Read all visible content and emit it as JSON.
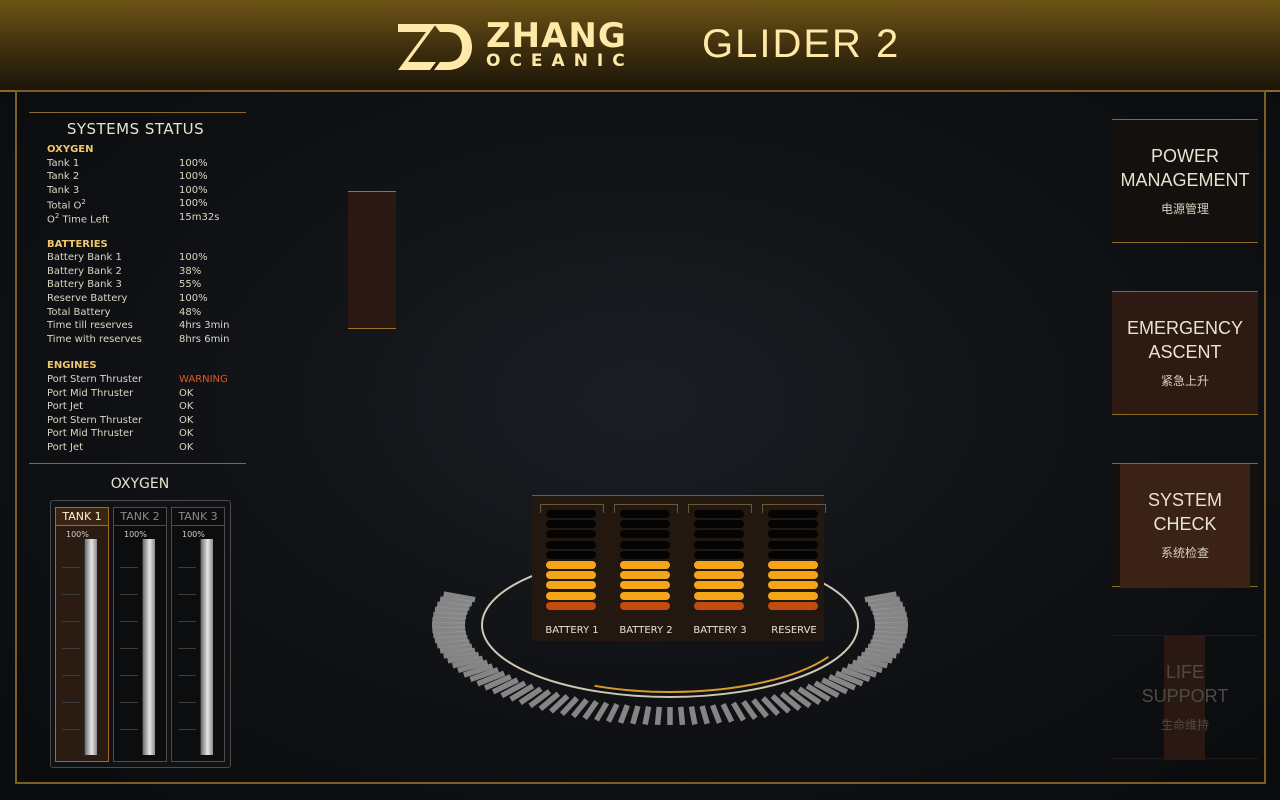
{
  "header": {
    "brand_top": "ZHANG",
    "brand_bottom": "OCEANIC",
    "product": "GLIDER 2",
    "logo_icon": "zd-logo-icon"
  },
  "systems_status": {
    "title": "SYSTEMS STATUS",
    "sections": [
      {
        "heading": "OXYGEN",
        "rows": [
          {
            "label": "Tank 1",
            "value": "100%"
          },
          {
            "label": "Tank 2",
            "value": "100%"
          },
          {
            "label": "Tank 3",
            "value": "100%"
          },
          {
            "label": "Total O",
            "sup": "2",
            "value": "100%"
          },
          {
            "label": "O",
            "sup": "2",
            "label_suffix": " Time Left",
            "value": "15m32s"
          }
        ]
      },
      {
        "heading": "BATTERIES",
        "rows": [
          {
            "label": "Battery Bank 1",
            "value": "100%"
          },
          {
            "label": "Battery Bank 2",
            "value": "38%"
          },
          {
            "label": "Battery Bank 3",
            "value": "55%"
          },
          {
            "label": "Reserve Battery",
            "value": "100%"
          },
          {
            "label": "Total Battery",
            "value": "48%"
          },
          {
            "label": "Time till reserves",
            "value": "4hrs 3min"
          },
          {
            "label": "Time with reserves",
            "value": "8hrs 6min"
          }
        ]
      },
      {
        "heading": "ENGINES",
        "rows": [
          {
            "label": "Port Stern Thruster",
            "value": "WARNING",
            "status": "warning"
          },
          {
            "label": "Port Mid Thruster",
            "value": "OK"
          },
          {
            "label": "Port Jet",
            "value": "OK"
          },
          {
            "label": "Port Stern Thruster",
            "value": "OK"
          },
          {
            "label": "Port Mid Thruster",
            "value": "OK"
          },
          {
            "label": "Port Jet",
            "value": "OK"
          }
        ]
      }
    ]
  },
  "oxygen": {
    "title": "OXYGEN",
    "tanks": [
      {
        "label": "TANK 1",
        "percent_label": "100%",
        "level": 1.0,
        "active": true
      },
      {
        "label": "TANK 2",
        "percent_label": "100%",
        "level": 1.0,
        "active": false
      },
      {
        "label": "TANK 3",
        "percent_label": "100%",
        "level": 1.0,
        "active": false
      }
    ]
  },
  "batteries": [
    {
      "label": "BATTERY 1",
      "lit_cells": 5,
      "total_cells": 10
    },
    {
      "label": "BATTERY 2",
      "lit_cells": 5,
      "total_cells": 10
    },
    {
      "label": "BATTERY 3",
      "lit_cells": 5,
      "total_cells": 10
    },
    {
      "label": "RESERVE",
      "lit_cells": 5,
      "total_cells": 10
    }
  ],
  "menu": [
    {
      "label": "POWER\nMANAGEMENT",
      "sub": "电源管理",
      "state": "normal"
    },
    {
      "label": "EMERGENCY\nASCENT",
      "sub": "紧急上升",
      "state": "warm"
    },
    {
      "label": "SYSTEM\nCHECK",
      "sub": "系统检查",
      "state": "selected"
    },
    {
      "label": "LIFE\nSUPPORT",
      "sub": "生命维持",
      "state": "dim"
    }
  ],
  "colors": {
    "accent_gold": "#ffe9a8",
    "frame_gold": "#8a6a25",
    "battery_on": "#f4a618",
    "battery_low": "#c14c0c",
    "warning": "#e05a1c"
  }
}
